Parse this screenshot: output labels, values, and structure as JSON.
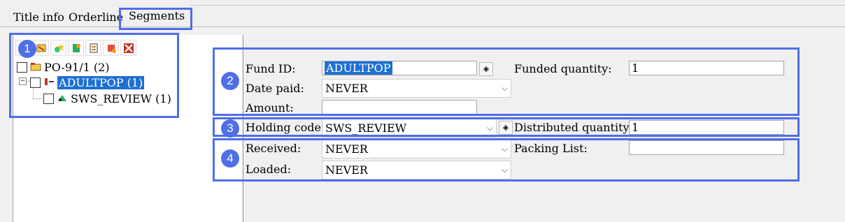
{
  "tabs": [
    {
      "label": "Title info"
    },
    {
      "label": "Orderline"
    },
    {
      "label": "Segments"
    }
  ],
  "tree": {
    "root": {
      "label": "PO-91/1 (2)"
    },
    "fund": {
      "label": "ADULTPOP (1)"
    },
    "holding": {
      "label": "SWS_REVIEW (1)"
    }
  },
  "form": {
    "fund_id": {
      "label": "Fund ID:",
      "value": "ADULTPOP"
    },
    "funded_quantity": {
      "label": "Funded quantity:",
      "value": "1"
    },
    "date_paid": {
      "label": "Date paid:",
      "value": "NEVER"
    },
    "amount": {
      "label": "Amount:",
      "value": ""
    },
    "holding_code": {
      "label": "Holding code:",
      "value": "SWS_REVIEW"
    },
    "distributed_quantity": {
      "label": "Distributed quantity:",
      "value": "1"
    },
    "received": {
      "label": "Received:",
      "value": "NEVER"
    },
    "packing_list": {
      "label": "Packing List:",
      "value": ""
    },
    "loaded": {
      "label": "Loaded:",
      "value": "NEVER"
    }
  },
  "annotations": [
    "1",
    "2",
    "3",
    "4"
  ],
  "colors": {
    "annotation": "#4f6ee8",
    "selection": "#1e70d2"
  },
  "toolbar_icons": [
    "split-segment-icon",
    "edit-segment-icon",
    "star-add-icon",
    "add-holding-icon",
    "notes-icon",
    "delete-segment-icon",
    "close-red-icon"
  ]
}
